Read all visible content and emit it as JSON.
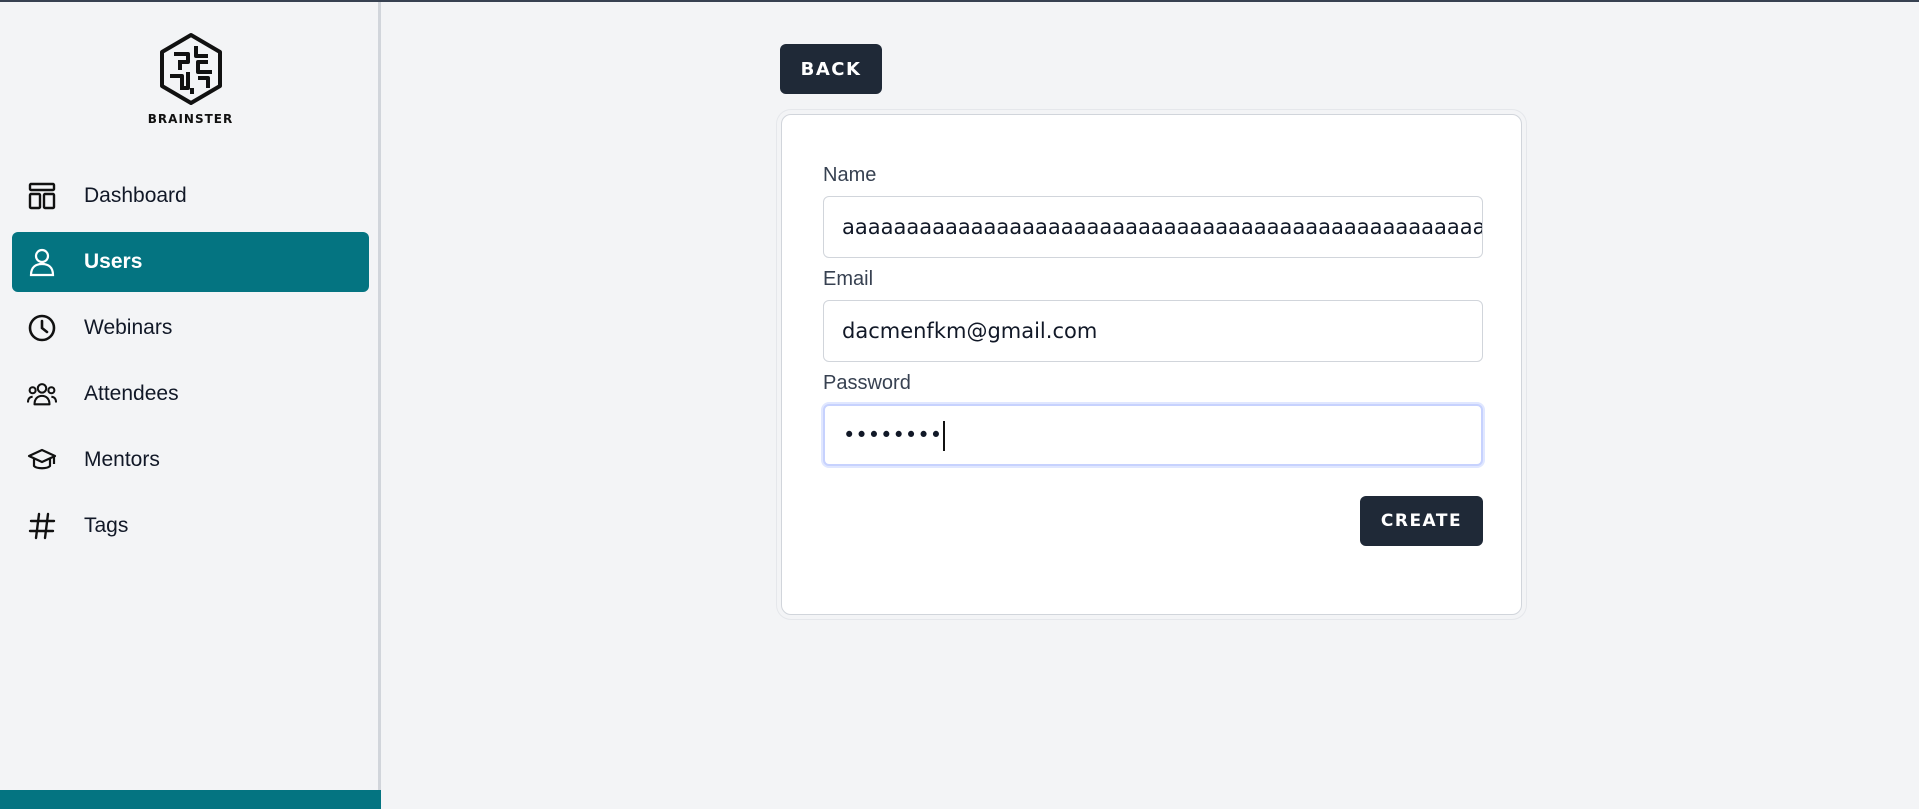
{
  "brand": {
    "name": "BRAINSTER",
    "logo_icon": "brain-icon"
  },
  "sidebar": {
    "items": [
      {
        "label": "Dashboard",
        "icon": "dashboard-icon",
        "active": false
      },
      {
        "label": "Users",
        "icon": "user-icon",
        "active": true
      },
      {
        "label": "Webinars",
        "icon": "clock-icon",
        "active": false
      },
      {
        "label": "Attendees",
        "icon": "group-icon",
        "active": false
      },
      {
        "label": "Mentors",
        "icon": "graduation-cap-icon",
        "active": false
      },
      {
        "label": "Tags",
        "icon": "hash-icon",
        "active": false
      }
    ]
  },
  "actions": {
    "back_label": "BACK",
    "create_label": "CREATE"
  },
  "form": {
    "name": {
      "label": "Name",
      "value": "aaaaaaaaaaaaaaaaaaaaaaaaaaaaaaaaaaaaaaaaaaaaaaaaaaaaa"
    },
    "email": {
      "label": "Email",
      "value": "dacmenfkm@gmail.com"
    },
    "password": {
      "label": "Password",
      "value": "••••••••"
    }
  },
  "colors": {
    "accent": "#047481",
    "button": "#1f2937",
    "background": "#f3f4f6"
  }
}
